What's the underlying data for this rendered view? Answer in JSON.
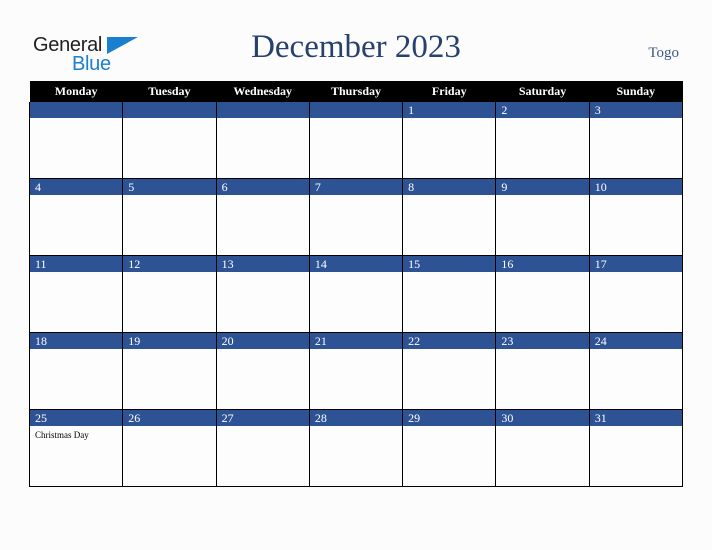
{
  "brand": {
    "line1": "General",
    "line2": "Blue",
    "triangle_icon": "triangle-icon",
    "color_dark": "#231f20",
    "color_blue": "#1b7fd1"
  },
  "header": {
    "title": "December 2023",
    "country": "Togo",
    "title_color": "#26416e",
    "country_color": "#3c5684"
  },
  "calendar": {
    "accent_color": "#2e5395",
    "header_bg": "#000000",
    "weekdays": [
      "Monday",
      "Tuesday",
      "Wednesday",
      "Thursday",
      "Friday",
      "Saturday",
      "Sunday"
    ],
    "weeks": [
      [
        {
          "date": "",
          "events": []
        },
        {
          "date": "",
          "events": []
        },
        {
          "date": "",
          "events": []
        },
        {
          "date": "",
          "events": []
        },
        {
          "date": "1",
          "events": []
        },
        {
          "date": "2",
          "events": []
        },
        {
          "date": "3",
          "events": []
        }
      ],
      [
        {
          "date": "4",
          "events": []
        },
        {
          "date": "5",
          "events": []
        },
        {
          "date": "6",
          "events": []
        },
        {
          "date": "7",
          "events": []
        },
        {
          "date": "8",
          "events": []
        },
        {
          "date": "9",
          "events": []
        },
        {
          "date": "10",
          "events": []
        }
      ],
      [
        {
          "date": "11",
          "events": []
        },
        {
          "date": "12",
          "events": []
        },
        {
          "date": "13",
          "events": []
        },
        {
          "date": "14",
          "events": []
        },
        {
          "date": "15",
          "events": []
        },
        {
          "date": "16",
          "events": []
        },
        {
          "date": "17",
          "events": []
        }
      ],
      [
        {
          "date": "18",
          "events": []
        },
        {
          "date": "19",
          "events": []
        },
        {
          "date": "20",
          "events": []
        },
        {
          "date": "21",
          "events": []
        },
        {
          "date": "22",
          "events": []
        },
        {
          "date": "23",
          "events": []
        },
        {
          "date": "24",
          "events": []
        }
      ],
      [
        {
          "date": "25",
          "events": [
            "Christmas Day"
          ]
        },
        {
          "date": "26",
          "events": []
        },
        {
          "date": "27",
          "events": []
        },
        {
          "date": "28",
          "events": []
        },
        {
          "date": "29",
          "events": []
        },
        {
          "date": "30",
          "events": []
        },
        {
          "date": "31",
          "events": []
        }
      ]
    ]
  }
}
